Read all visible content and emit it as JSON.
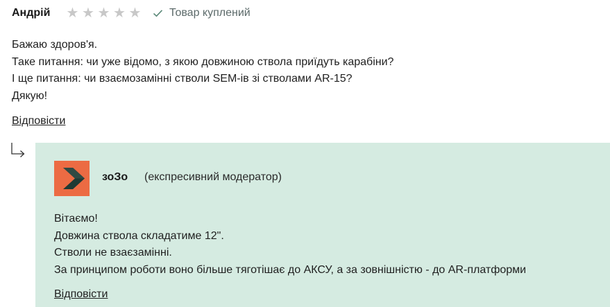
{
  "review": {
    "author": "Андрій",
    "rating": 0,
    "max_rating": 5,
    "purchased_label": "Товар куплений",
    "lines": [
      "Бажаю здоров'я.",
      "Таке питання: чи уже відомо, з якою довжиною ствола приїдуть карабіни?",
      "І ще питання: чи взаємозамінні стволи SEM-ів зі стволами AR-15?",
      "Дякую!"
    ],
    "reply_label": "Відповісти"
  },
  "answer": {
    "name": "зоЗо",
    "role": "(експресивний модератор)",
    "lines": [
      "Вітаємо!",
      "Довжина ствола складатиме 12\".",
      "Стволи не взаєзамінні.",
      "За принципом роботи воно більше тяготішає до АКСУ, а за зовнішністю - до AR-платформи"
    ],
    "reply_label": "Відповісти"
  },
  "colors": {
    "answer_bg": "#d5ebe1",
    "avatar_bg": "#ec6b43",
    "star_empty": "#c8c8c8",
    "check": "#5c8a7a"
  },
  "icons": {
    "star": "star-icon",
    "check": "check-icon",
    "reply_arrow": "reply-arrow-icon",
    "avatar": "moderator-logo"
  }
}
